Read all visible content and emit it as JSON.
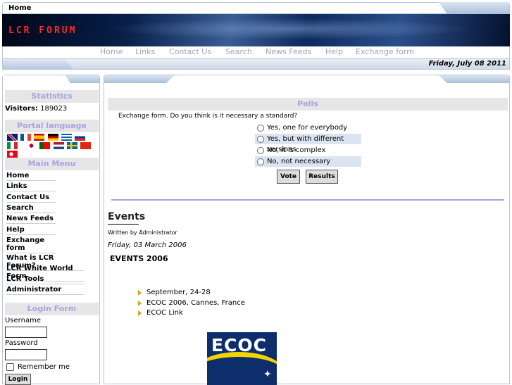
{
  "topbar": {
    "home_label": "Home"
  },
  "banner": {
    "logo_text": "LCR FORUM"
  },
  "nav": {
    "items": [
      "Home",
      "Links",
      "Contact Us",
      "Search",
      "News Feeds",
      "Help",
      "Exchange form"
    ]
  },
  "date": "Friday, July 08 2011",
  "sidebar": {
    "statistics_title": "Statistics",
    "visitors_label": "Visitors:",
    "visitors_value": "189023",
    "portal_language_title": "Portal language",
    "flag_names": [
      "en-flag",
      "fr-flag",
      "es-flag",
      "de-flag",
      "gr-flag",
      "ru-flag",
      "it-flag",
      "jp-flag",
      "pt-flag",
      "nl-flag",
      "se-flag",
      "cn-flag",
      "tr-flag"
    ],
    "main_menu_title": "Main Menu",
    "menu_items": [
      "Home",
      "Links",
      "Contact Us",
      "Search",
      "News Feeds",
      "Help",
      "Exchange form"
    ],
    "extra_items": [
      "What is LCR Forum?",
      "LCR White World Form",
      "LCR Tools",
      "Administrator"
    ],
    "login_title": "Login Form",
    "username_label": "Username",
    "password_label": "Password",
    "remember_label": "Remember me",
    "login_button": "Login"
  },
  "polls": {
    "title": "Polls",
    "question": "Exchange form. Do you think is it necessary a standard?",
    "options": [
      "Yes, one for everybody",
      "Yes, but with different versions",
      "No, it is complex",
      "No, not necessary"
    ],
    "vote_label": "Vote",
    "results_label": "Results"
  },
  "article": {
    "title": "Events",
    "written_by": "Written by Administrator",
    "date": "Friday, 03 March 2006",
    "heading": "EVENTS 2006",
    "items": [
      "September, 24-28",
      "ECOC 2006, Cannes, France",
      "ECOC Link"
    ],
    "logo_text": "ECOC"
  },
  "colors": {
    "section_title": "#a8a3e3",
    "section_bg": "#e6e6e6",
    "logo_red": "#ff2a2a",
    "nav_text": "#9aa4b8"
  }
}
